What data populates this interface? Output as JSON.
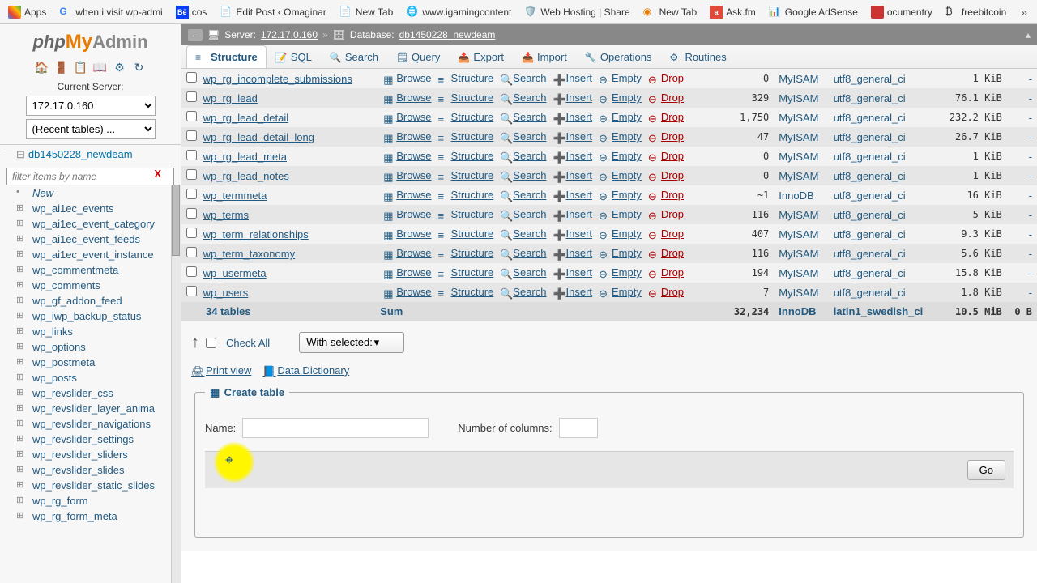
{
  "bookmarks": [
    {
      "label": "Apps",
      "icon": "grid"
    },
    {
      "label": "when i visit wp-admi",
      "icon": "g"
    },
    {
      "label": "cos",
      "icon": "be"
    },
    {
      "label": "Edit Post ‹ Omaginar",
      "icon": "doc"
    },
    {
      "label": "New Tab",
      "icon": "tab"
    },
    {
      "label": "www.igamingcontent",
      "icon": "globe"
    },
    {
      "label": "Web Hosting | Share",
      "icon": "host"
    },
    {
      "label": "New Tab",
      "icon": "tab"
    },
    {
      "label": "Ask.fm",
      "icon": "ask"
    },
    {
      "label": "Google AdSense",
      "icon": "ad"
    },
    {
      "label": "ocumentry",
      "icon": "doc2"
    },
    {
      "label": "freebitcoin",
      "icon": "bc"
    }
  ],
  "logo": {
    "php": "php",
    "my": "My",
    "admin": "Admin"
  },
  "server": {
    "label": "Current Server:",
    "value": "172.17.0.160",
    "recent": "(Recent tables) ..."
  },
  "tree": {
    "db": "db1450228_newdeam",
    "filter_placeholder": "filter items by name",
    "new": "New",
    "items": [
      "wp_ai1ec_events",
      "wp_ai1ec_event_category",
      "wp_ai1ec_event_feeds",
      "wp_ai1ec_event_instance",
      "wp_commentmeta",
      "wp_comments",
      "wp_gf_addon_feed",
      "wp_iwp_backup_status",
      "wp_links",
      "wp_options",
      "wp_postmeta",
      "wp_posts",
      "wp_revslider_css",
      "wp_revslider_layer_anima",
      "wp_revslider_navigations",
      "wp_revslider_settings",
      "wp_revslider_sliders",
      "wp_revslider_slides",
      "wp_revslider_static_slides",
      "wp_rg_form",
      "wp_rg_form_meta"
    ]
  },
  "breadcrumb": {
    "server_lbl": "Server:",
    "server": "172.17.0.160",
    "db_lbl": "Database:",
    "db": "db1450228_newdeam"
  },
  "tabs": [
    "Structure",
    "SQL",
    "Search",
    "Query",
    "Export",
    "Import",
    "Operations",
    "Routines"
  ],
  "actions": {
    "browse": "Browse",
    "structure": "Structure",
    "search": "Search",
    "insert": "Insert",
    "empty": "Empty",
    "drop": "Drop"
  },
  "rows": [
    {
      "name": "wp_rg_incomplete_submissions",
      "cnt": "0",
      "engine": "MyISAM",
      "coll": "utf8_general_ci",
      "size": "1 KiB",
      "over": "-"
    },
    {
      "name": "wp_rg_lead",
      "cnt": "329",
      "engine": "MyISAM",
      "coll": "utf8_general_ci",
      "size": "76.1 KiB",
      "over": "-"
    },
    {
      "name": "wp_rg_lead_detail",
      "cnt": "1,750",
      "engine": "MyISAM",
      "coll": "utf8_general_ci",
      "size": "232.2 KiB",
      "over": "-"
    },
    {
      "name": "wp_rg_lead_detail_long",
      "cnt": "47",
      "engine": "MyISAM",
      "coll": "utf8_general_ci",
      "size": "26.7 KiB",
      "over": "-"
    },
    {
      "name": "wp_rg_lead_meta",
      "cnt": "0",
      "engine": "MyISAM",
      "coll": "utf8_general_ci",
      "size": "1 KiB",
      "over": "-"
    },
    {
      "name": "wp_rg_lead_notes",
      "cnt": "0",
      "engine": "MyISAM",
      "coll": "utf8_general_ci",
      "size": "1 KiB",
      "over": "-"
    },
    {
      "name": "wp_termmeta",
      "cnt": "~1",
      "engine": "InnoDB",
      "coll": "utf8_general_ci",
      "size": "16 KiB",
      "over": "-"
    },
    {
      "name": "wp_terms",
      "cnt": "116",
      "engine": "MyISAM",
      "coll": "utf8_general_ci",
      "size": "5 KiB",
      "over": "-"
    },
    {
      "name": "wp_term_relationships",
      "cnt": "407",
      "engine": "MyISAM",
      "coll": "utf8_general_ci",
      "size": "9.3 KiB",
      "over": "-"
    },
    {
      "name": "wp_term_taxonomy",
      "cnt": "116",
      "engine": "MyISAM",
      "coll": "utf8_general_ci",
      "size": "5.6 KiB",
      "over": "-"
    },
    {
      "name": "wp_usermeta",
      "cnt": "194",
      "engine": "MyISAM",
      "coll": "utf8_general_ci",
      "size": "15.8 KiB",
      "over": "-"
    },
    {
      "name": "wp_users",
      "cnt": "7",
      "engine": "MyISAM",
      "coll": "utf8_general_ci",
      "size": "1.8 KiB",
      "over": "-"
    }
  ],
  "sum": {
    "label": "34 tables",
    "sumlbl": "Sum",
    "cnt": "32,234",
    "engine": "InnoDB",
    "coll": "latin1_swedish_ci",
    "size": "10.5 MiB",
    "over": "0 B"
  },
  "checkall": "Check All",
  "withsel": "With selected:",
  "print": "Print view",
  "dict": "Data Dictionary",
  "create": {
    "legend": "Create table",
    "name": "Name:",
    "cols": "Number of columns:",
    "go": "Go"
  }
}
